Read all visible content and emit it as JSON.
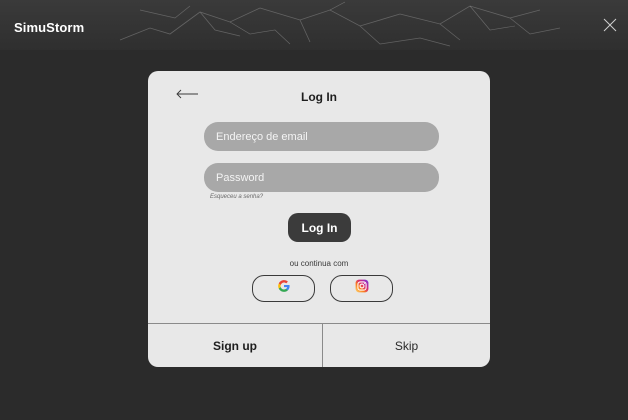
{
  "window": {
    "app_title": "SimuStorm",
    "close_icon": "close-icon"
  },
  "login": {
    "title": "Log In",
    "back_icon": "arrow-left-icon",
    "email_placeholder": "Endereço de email",
    "password_placeholder": "Password",
    "forgot_link": "Esqueceu a senha?",
    "login_button": "Log In",
    "alt_login_text": "ou continua com",
    "social": [
      {
        "name": "Google",
        "icon": "google-icon"
      },
      {
        "name": "Instagram",
        "icon": "instagram-icon"
      }
    ]
  },
  "footer": {
    "signup_label": "Sign up",
    "skip_label": "Skip"
  },
  "colors": {
    "background": "#2b2b2b",
    "dialog": "#e8e8e8",
    "field": "#a8a8a8",
    "primary_button": "#3b3b3b"
  }
}
